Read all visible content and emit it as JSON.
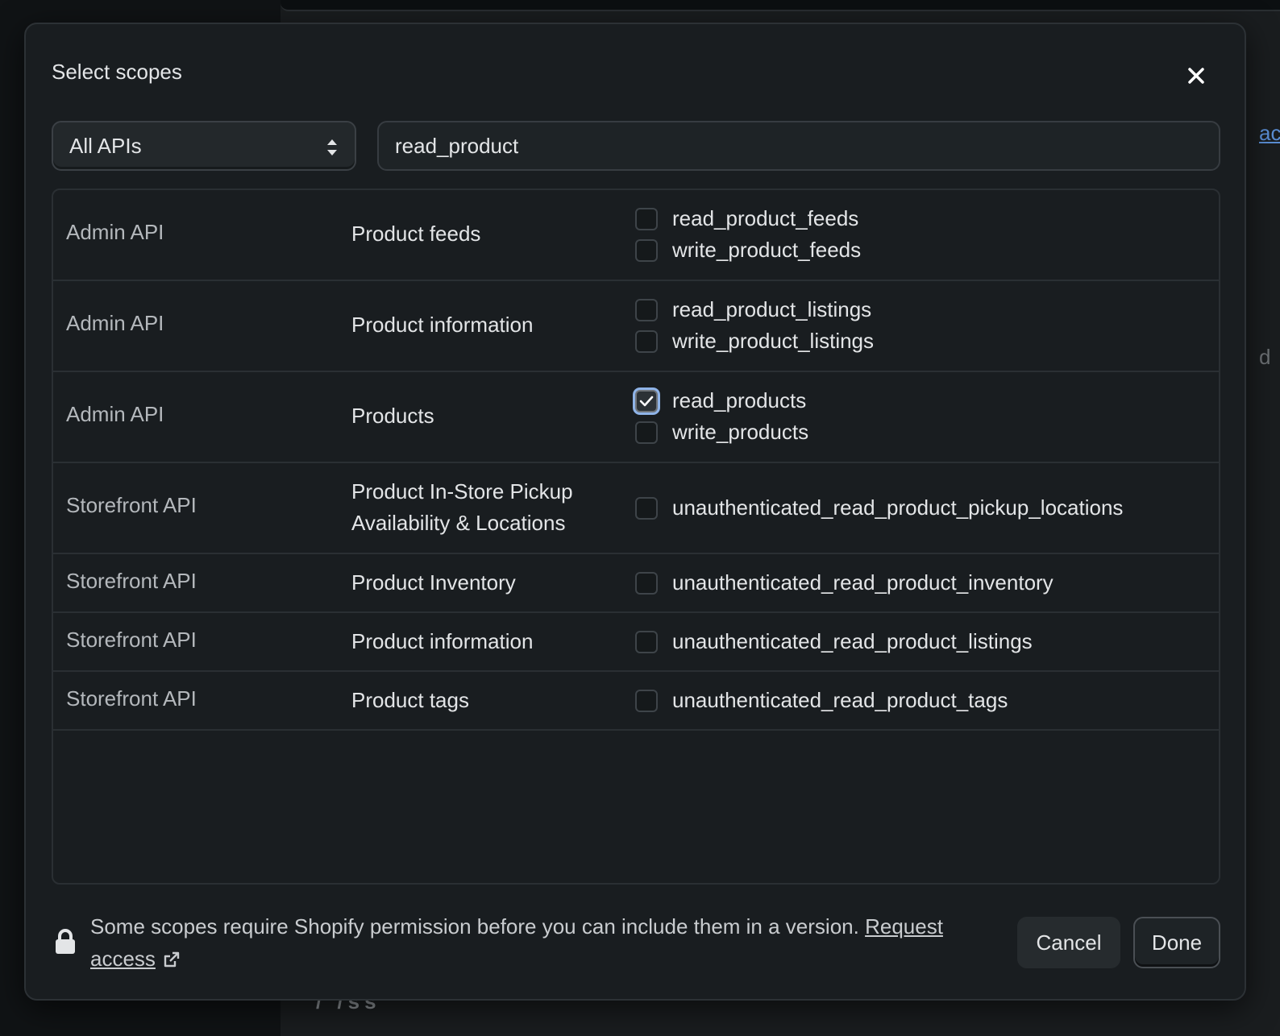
{
  "background": {
    "frag_top": "ac",
    "frag_mid": "d",
    "bottom_text": "/ /ss"
  },
  "modal": {
    "title": "Select scopes",
    "close_icon": "close-icon"
  },
  "filter": {
    "api_select": "All APIs",
    "search_value": "read_product"
  },
  "rows": [
    {
      "api": "Admin API",
      "name": "Product feeds",
      "scopes": [
        {
          "label": "read_product_feeds",
          "checked": false
        },
        {
          "label": "write_product_feeds",
          "checked": false
        }
      ]
    },
    {
      "api": "Admin API",
      "name": "Product information",
      "scopes": [
        {
          "label": "read_product_listings",
          "checked": false
        },
        {
          "label": "write_product_listings",
          "checked": false
        }
      ]
    },
    {
      "api": "Admin API",
      "name": "Products",
      "scopes": [
        {
          "label": "read_products",
          "checked": true
        },
        {
          "label": "write_products",
          "checked": false
        }
      ]
    },
    {
      "api": "Storefront API",
      "name_line1": "Product In-Store Pickup",
      "name_line2": "Availability & Locations",
      "scopes": [
        {
          "label": "unauthenticated_read_product_pickup_locations",
          "checked": false
        }
      ]
    },
    {
      "api": "Storefront API",
      "name": "Product Inventory",
      "scopes": [
        {
          "label": "unauthenticated_read_product_inventory",
          "checked": false
        }
      ]
    },
    {
      "api": "Storefront API",
      "name": "Product information",
      "scopes": [
        {
          "label": "unauthenticated_read_product_listings",
          "checked": false
        }
      ]
    },
    {
      "api": "Storefront API",
      "name": "Product tags",
      "scopes": [
        {
          "label": "unauthenticated_read_product_tags",
          "checked": false
        }
      ]
    }
  ],
  "footer": {
    "notice": "Some scopes require Shopify permission before you can include them in a version.",
    "request_link": "Request access",
    "cancel_label": "Cancel",
    "done_label": "Done"
  }
}
